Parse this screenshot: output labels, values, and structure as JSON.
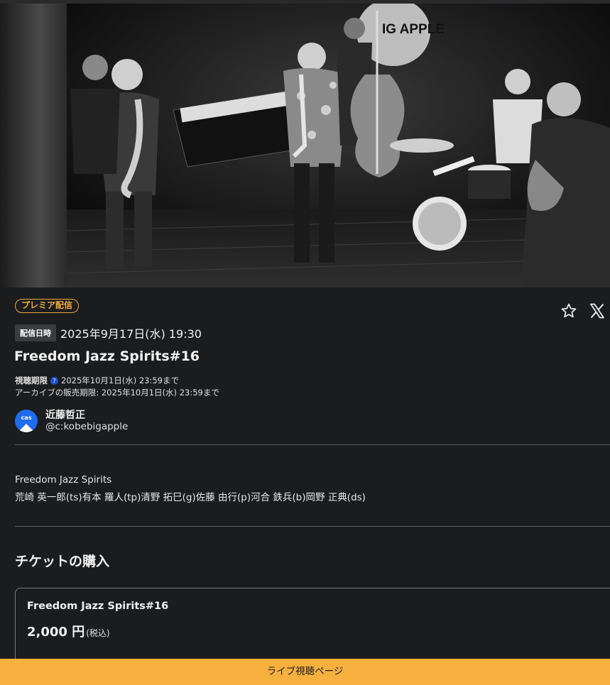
{
  "hero": {
    "venue_sign": "IG APPLE"
  },
  "event": {
    "badge": "プレミア配信",
    "date_label": "配信日時",
    "date_value": "2025年9月17日(水) 19:30",
    "title": "Freedom Jazz Spirits#16",
    "viewing_limit_label": "視聴期限",
    "viewing_limit_value": "2025年10月1日(水) 23:59まで",
    "archive_sale_label": "アーカイブの販売期限:",
    "archive_sale_value": "2025年10月1日(水) 23:59まで"
  },
  "owner": {
    "avatar_text": "cas",
    "name": "近藤哲正",
    "id": "@c:kobebigapple"
  },
  "description": {
    "line1": "Freedom Jazz Spirits",
    "line2": "荒崎 英一郎(ts)有本 羅人(tp)清野 拓巳(g)佐藤 由行(p)河合 鉄兵(b)岡野 正典(ds)"
  },
  "tickets": {
    "section_title": "チケットの購入",
    "items": [
      {
        "name": "Freedom Jazz Spirits#16",
        "price": "2,000 円",
        "tax": "(税込)"
      }
    ]
  },
  "cta": {
    "label": "ライブ視聴ページ"
  },
  "colors": {
    "accent": "#f8b03f",
    "badge": "#f2a93b",
    "background": "#1b1c1e",
    "link_blue": "#1e6cf0"
  }
}
